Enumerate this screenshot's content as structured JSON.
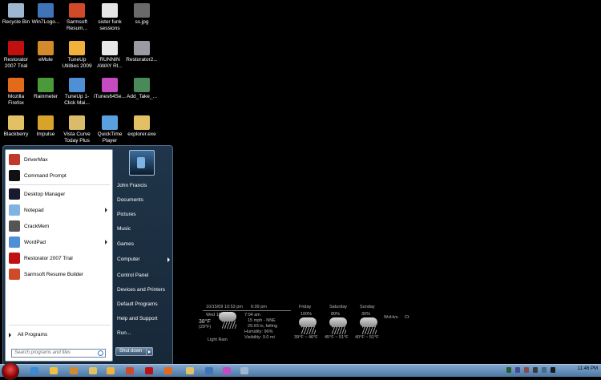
{
  "desktop_icons": [
    {
      "label": "Recycle Bin",
      "color": "#9db7d0"
    },
    {
      "label": "Win7Logo...",
      "color": "#3f74b7"
    },
    {
      "label": "Sarmsoft Resum...",
      "color": "#d04a2a"
    },
    {
      "label": "sister funk sessions",
      "color": "#e6e6e6"
    },
    {
      "label": "ss.jpg",
      "color": "#6a6a6a"
    },
    {
      "label": "Restorator 2007 Trial",
      "color": "#c01010"
    },
    {
      "label": "eMule",
      "color": "#d28a2c"
    },
    {
      "label": "TuneUp Utilities 2009",
      "color": "#f0b23a"
    },
    {
      "label": "RUNNIN AWAY Rl...",
      "color": "#e8e8e8"
    },
    {
      "label": "Restorator2...",
      "color": "#9a9aa0"
    },
    {
      "label": "Mozilla Firefox",
      "color": "#e36a1b"
    },
    {
      "label": "Rainmeter",
      "color": "#4a9a3a"
    },
    {
      "label": "TuneUp 1-Click Mai...",
      "color": "#4e8fd6"
    },
    {
      "label": "iTunes64Se...",
      "color": "#c44bc0"
    },
    {
      "label": "Add_Take_...",
      "color": "#4a8a5a"
    },
    {
      "label": "Blackberry",
      "color": "#e2c063"
    },
    {
      "label": "Impulse",
      "color": "#d9a22a"
    },
    {
      "label": "Vista Curve Today Plus",
      "color": "#d9bb6a"
    },
    {
      "label": "QuickTime Player",
      "color": "#5aa0e0"
    },
    {
      "label": "explorer.exe",
      "color": "#e2c063"
    }
  ],
  "start_menu": {
    "programs": [
      {
        "label": "DriverMax",
        "color": "#c0392b",
        "has_arrow": false
      },
      {
        "label": "Command Prompt",
        "color": "#111111",
        "has_arrow": false
      },
      {
        "label": "Desktop Manager",
        "color": "#1a1a2e",
        "has_arrow": false
      },
      {
        "label": "Notepad",
        "color": "#7fb4e2",
        "has_arrow": true
      },
      {
        "label": "CrackMem",
        "color": "#555555",
        "has_arrow": false
      },
      {
        "label": "WordPad",
        "color": "#4e8fd6",
        "has_arrow": true
      },
      {
        "label": "Restorator 2007 Trial",
        "color": "#c01010",
        "has_arrow": false
      },
      {
        "label": "Sarmsoft Resume Builder",
        "color": "#d04a2a",
        "has_arrow": false
      }
    ],
    "all_programs": "All Programs",
    "search_placeholder": "Search programs and files",
    "right_items": [
      {
        "label": "John Francis",
        "has_arrow": false
      },
      {
        "label": "Documents",
        "has_arrow": false
      },
      {
        "label": "Pictures",
        "has_arrow": false
      },
      {
        "label": "Music",
        "has_arrow": false
      },
      {
        "label": "Games",
        "has_arrow": false
      },
      {
        "label": "Computer",
        "has_arrow": true
      },
      {
        "label": "Control Panel",
        "has_arrow": false
      },
      {
        "label": "Devices and Printers",
        "has_arrow": false
      },
      {
        "label": "Default Programs",
        "has_arrow": false
      },
      {
        "label": "Help and Support",
        "has_arrow": false
      },
      {
        "label": "Run...",
        "has_arrow": false
      }
    ],
    "shutdown": "Shut down"
  },
  "weather": {
    "datetime": "10/15/09 10:53 pm",
    "sunset": "6:09 pm",
    "today": "Wed 15",
    "temp": "38°F",
    "feels": "(29°F)",
    "sunrise": "7:04 am",
    "wind": "15 mph - NNE",
    "pressure": "29.93 in, falling",
    "humidity": "Humidity: 96%",
    "visibility": "Visibility: 9.0 mi",
    "condition": "Light Rain",
    "days": [
      {
        "name": "Friday",
        "chance": "100%",
        "range": "39°F ~ 46°F"
      },
      {
        "name": "Saturday",
        "chance": "80%",
        "range": "45°F ~ 51°F"
      },
      {
        "name": "Sunday",
        "chance": "30%",
        "range": "40°F ~ 51°F"
      }
    ],
    "extra1": "WxHvn",
    "extra2": "Ct"
  },
  "taskbar": {
    "clock": "11:46 PM",
    "pinned_colors": [
      "#3a8ad6",
      "#f0c040",
      "#d28a2c",
      "#e2c063",
      "#f0b23a",
      "#d04a2a",
      "#c01010",
      "#e36a1b",
      "#e2c063",
      "#3f74b7",
      "#c44bc0",
      "#9db7d0"
    ],
    "tray_colors": [
      "#2a5a2a",
      "#4a4a8a",
      "#8a4a4a",
      "#3a3a3a",
      "#4a6a8a",
      "#1a1a1a"
    ]
  }
}
